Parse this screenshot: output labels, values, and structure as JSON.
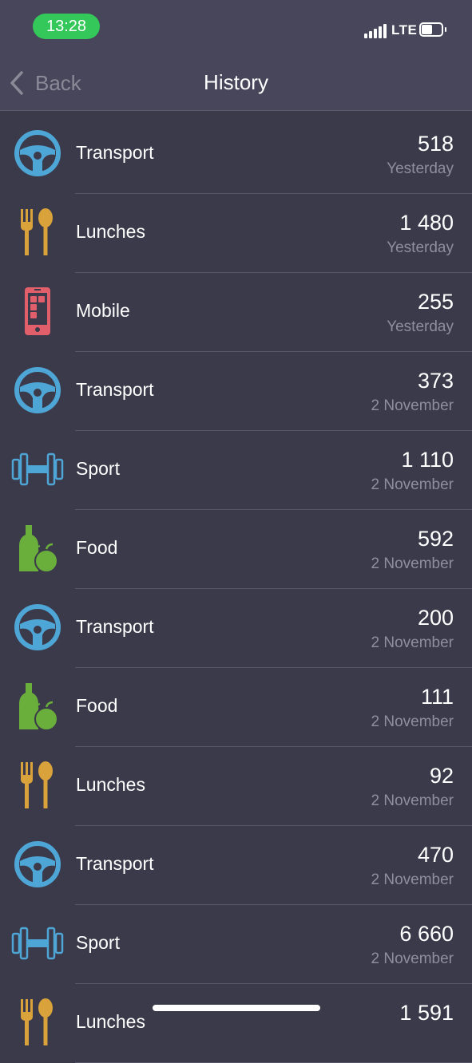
{
  "status": {
    "time": "13:28",
    "network": "LTE"
  },
  "nav": {
    "back_label": "Back",
    "title": "History"
  },
  "colors": {
    "transport": "#4ea6d6",
    "lunches": "#d9a23a",
    "mobile": "#e05f6b",
    "sport": "#4ea6d6",
    "food": "#6aae3b"
  },
  "history": [
    {
      "category": "Transport",
      "icon": "steering-wheel-icon",
      "amount": "518",
      "date": "Yesterday"
    },
    {
      "category": "Lunches",
      "icon": "fork-spoon-icon",
      "amount": "1 480",
      "date": "Yesterday"
    },
    {
      "category": "Mobile",
      "icon": "smartphone-icon",
      "amount": "255",
      "date": "Yesterday"
    },
    {
      "category": "Transport",
      "icon": "steering-wheel-icon",
      "amount": "373",
      "date": "2 November"
    },
    {
      "category": "Sport",
      "icon": "dumbbell-icon",
      "amount": "1 110",
      "date": "2 November"
    },
    {
      "category": "Food",
      "icon": "bottle-apple-icon",
      "amount": "592",
      "date": "2 November"
    },
    {
      "category": "Transport",
      "icon": "steering-wheel-icon",
      "amount": "200",
      "date": "2 November"
    },
    {
      "category": "Food",
      "icon": "bottle-apple-icon",
      "amount": "111",
      "date": "2 November"
    },
    {
      "category": "Lunches",
      "icon": "fork-spoon-icon",
      "amount": "92",
      "date": "2 November"
    },
    {
      "category": "Transport",
      "icon": "steering-wheel-icon",
      "amount": "470",
      "date": "2 November"
    },
    {
      "category": "Sport",
      "icon": "dumbbell-icon",
      "amount": "6 660",
      "date": "2 November"
    },
    {
      "category": "Lunches",
      "icon": "fork-spoon-icon",
      "amount": "1 591",
      "date": ""
    }
  ]
}
